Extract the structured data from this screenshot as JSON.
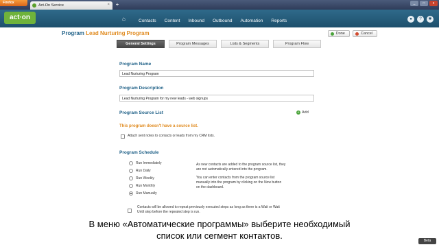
{
  "browser": {
    "menu_button": "Firefox",
    "tab_title": "Act-On Service",
    "new_tab": "+",
    "controls": [
      "_",
      "□",
      "x"
    ]
  },
  "app": {
    "logo": "act·on",
    "nav": [
      "Contacts",
      "Content",
      "Inbound",
      "Outbound",
      "Automation",
      "Reports"
    ]
  },
  "page": {
    "title_prefix": "Program ",
    "title_name": "Lead Nurturing Program",
    "done_label": "Done",
    "cancel_label": "Cancel"
  },
  "tabs": [
    "General Settings",
    "Program Messages",
    "Lists & Segments",
    "Program Flow"
  ],
  "form": {
    "name_label": "Program Name",
    "name_value": "Lead Nurturing Program",
    "desc_label": "Program Description",
    "desc_value": "Lead Nurturing Program for my new leads - web signups",
    "source_label": "Program Source List",
    "add_label": "Add",
    "warning": "This program doesn't have a source list.",
    "attach_label": "Attach sent notes to contacts or leads from my CRM lists.",
    "schedule_label": "Program Schedule",
    "schedule_options": [
      "Run Immediately",
      "Run Daily",
      "Run Weekly",
      "Run Monthly",
      "Run Manually"
    ],
    "schedule_selected": "Run Manually",
    "info_1_a": "As new contacts are added to the program source list, they",
    "info_1_b": "are not automatically entered into the program.",
    "info_2_a": "You can enter contacts from the program source list",
    "info_2_b": "manually into the program by clicking on the Now button",
    "info_2_c": "on the dashboard.",
    "repeat_a": "Contacts will be allowed to repeat previously executed steps as long as there is a Wait or Wait",
    "repeat_b": "Until step before the repeated step is run."
  },
  "subtitle": {
    "line1": "В меню «Автоматические программы» выберите необходимый",
    "line2": "список или сегмент контактов."
  },
  "beta_badge": "Beta"
}
